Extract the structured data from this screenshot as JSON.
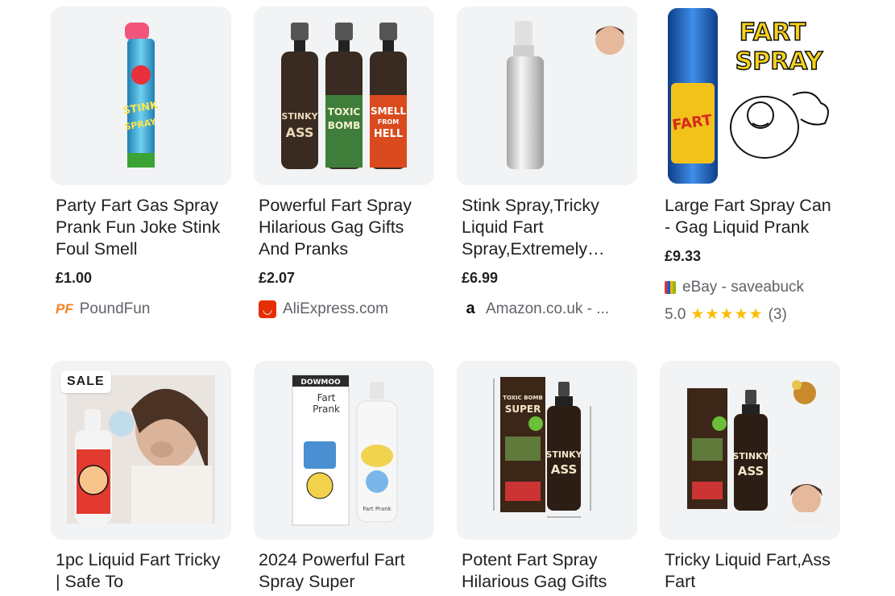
{
  "products": [
    {
      "title": "Party Fart Gas Spray Prank Fun Joke Stink Foul Smell",
      "price": "£1.00",
      "merchant": "PoundFun",
      "merchant_icon": "poundfun-logo",
      "image_text": [
        "STINK",
        "SPRAY"
      ]
    },
    {
      "title": "Powerful Fart Spray Hilarious Gag Gifts And Pranks",
      "price": "£2.07",
      "merchant": "AliExpress.com",
      "merchant_icon": "aliexpress-logo",
      "image_text": [
        "STINKY",
        "ASS",
        "TOXIC",
        "BOMB",
        "SMELL",
        "FROM",
        "HELL"
      ]
    },
    {
      "title": "Stink Spray,Tricky Liquid Fart Spray,Extremely Smelly",
      "price": "£6.99",
      "merchant": "Amazon.co.uk - ...",
      "merchant_icon": "amazon-logo"
    },
    {
      "title": "Large Fart Spray Can - Gag Liquid Prank",
      "price": "£9.33",
      "merchant": "eBay - saveabuck",
      "merchant_icon": "ebay-bag-icon",
      "rating": "5.0",
      "stars": "★★★★★",
      "reviews": "(3)",
      "image_text": [
        "FART",
        "SPRAY"
      ]
    },
    {
      "title": "1pc Liquid Fart Tricky | Safe To",
      "badge": "SALE"
    },
    {
      "title": "2024 Powerful Fart Spray Super",
      "image_text": [
        "DOWMOO",
        "Fart",
        "Prank",
        "Fart Prank"
      ]
    },
    {
      "title": "Potent Fart Spray Hilarious Gag Gifts",
      "image_text": [
        "TOXIC BOMB",
        "SUPER",
        "STINKY",
        "ASS"
      ]
    },
    {
      "title": "Tricky Liquid Fart,Ass Fart",
      "image_text": [
        "STINKY",
        "ASS"
      ]
    }
  ],
  "colors": {
    "card_bg": "#f1f3f4",
    "star": "#fbbc04",
    "aliexpress": "#e62e04",
    "poundfun": "#f58220"
  }
}
